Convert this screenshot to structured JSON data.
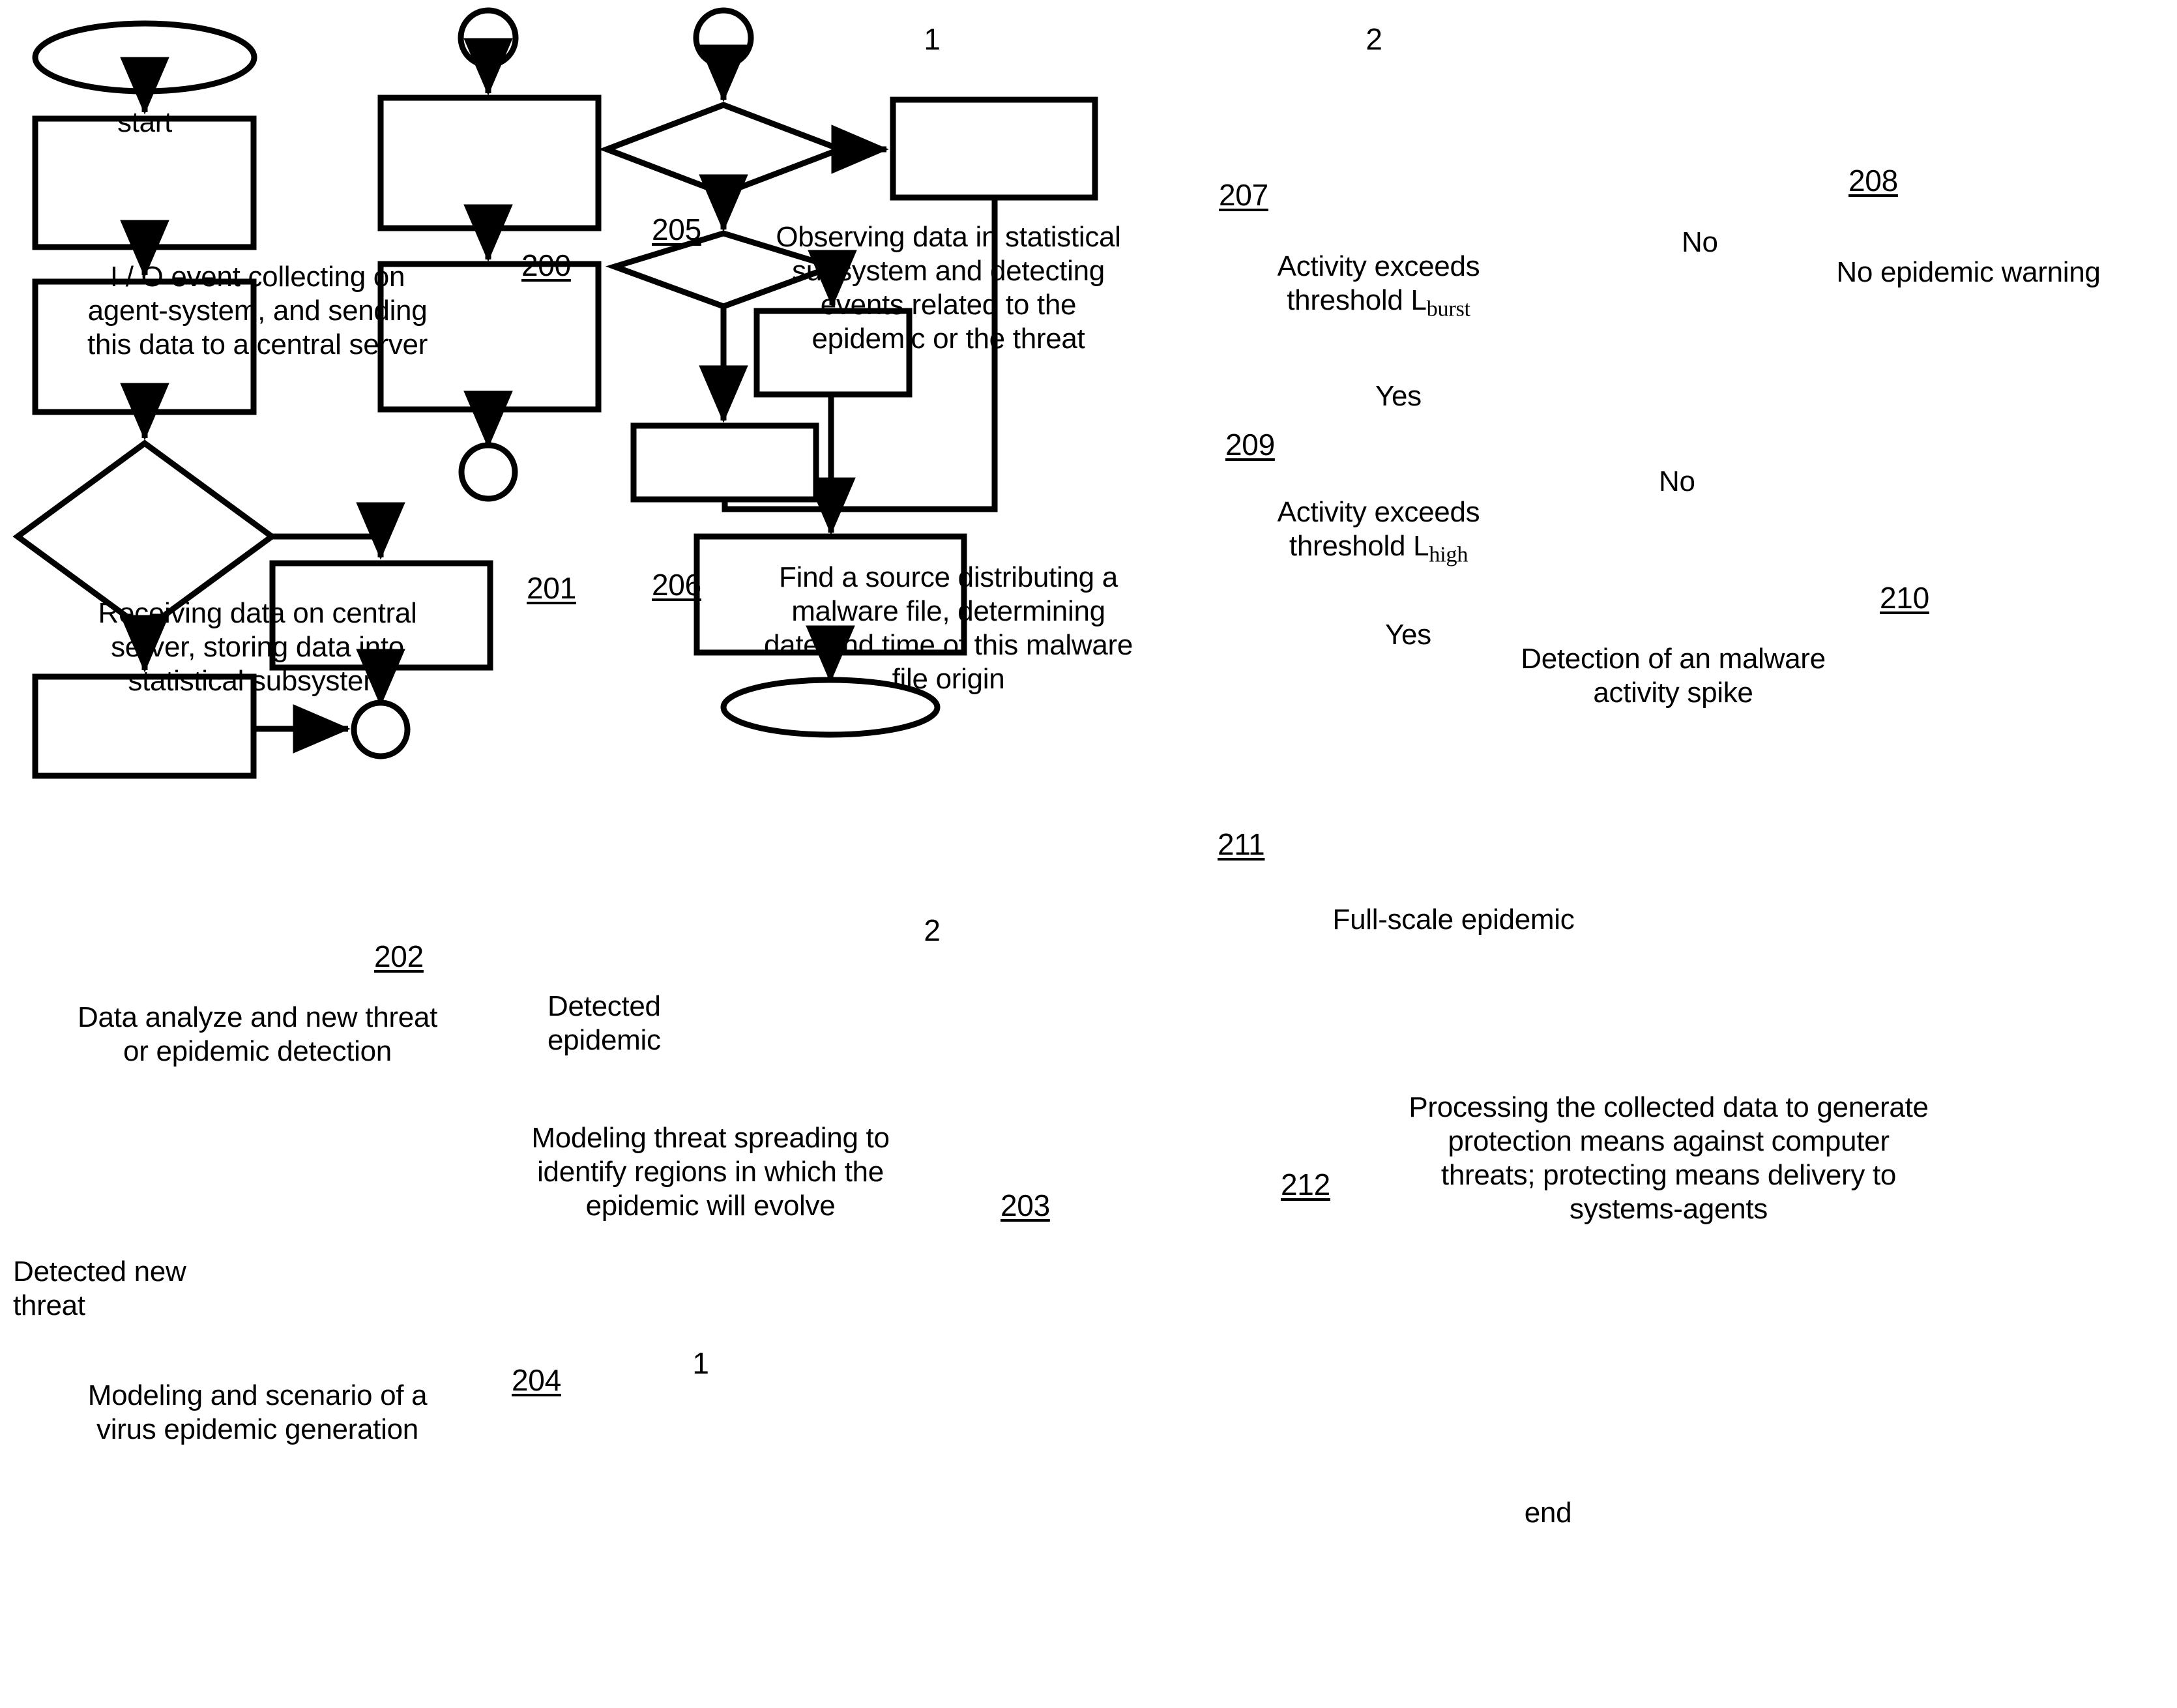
{
  "figure": {
    "type": "flowchart",
    "background": "#ffffff",
    "line_color": "#000000"
  },
  "terminators": {
    "start": "start",
    "end": "end"
  },
  "connectors": {
    "one": "1",
    "two": "2"
  },
  "nodes": {
    "n200": {
      "ref": "200",
      "shape": "process",
      "text": "I / O event collecting on agent-system, and sending this data to a central server"
    },
    "n201": {
      "ref": "201",
      "shape": "process",
      "text": "Receiving data on central server, storing data into statistical subsystem"
    },
    "n202": {
      "ref": "202",
      "shape": "decision",
      "text": "Data analyze and new threat or epidemic detection"
    },
    "n203": {
      "ref": "203",
      "shape": "process",
      "text": "Modeling threat spreading to identify regions in which the epidemic will evolve"
    },
    "n204": {
      "ref": "204",
      "shape": "process",
      "text": "Modeling and scenario of a virus epidemic generation"
    },
    "n205": {
      "ref": "205",
      "shape": "process",
      "text": "Observing data in statistical subsystem and detecting events related to the epidemic or the threat"
    },
    "n206": {
      "ref": "206",
      "shape": "process",
      "text": "Find a source distributing a malware file, determining date and time of this malware file origin"
    },
    "n207": {
      "ref": "207",
      "shape": "decision",
      "text_prefix": "Activity exceeds threshold L",
      "text_subscript": "burst"
    },
    "n208": {
      "ref": "208",
      "shape": "process",
      "text": "No epidemic warning"
    },
    "n209": {
      "ref": "209",
      "shape": "decision",
      "text_prefix": "Activity exceeds threshold L",
      "text_subscript": "high"
    },
    "n210": {
      "ref": "210",
      "shape": "process",
      "text": "Detection of an malware activity spike"
    },
    "n211": {
      "ref": "211",
      "shape": "process",
      "text": "Full-scale epidemic"
    },
    "n212": {
      "ref": "212",
      "shape": "process",
      "text": "Processing the collected data to generate protection means against computer threats; protecting means delivery to systems-agents"
    }
  },
  "edge_labels": {
    "detected_epidemic": "Detected epidemic",
    "detected_new_threat": "Detected new threat",
    "no_207": "No",
    "yes_207": "Yes",
    "no_209": "No",
    "yes_209": "Yes"
  }
}
